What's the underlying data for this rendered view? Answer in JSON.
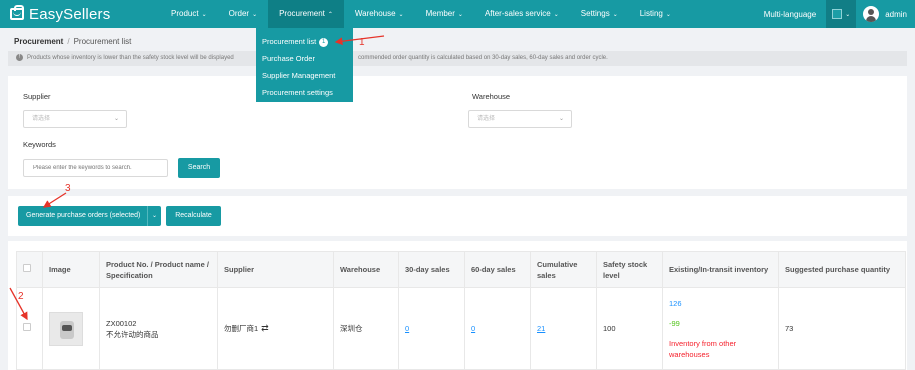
{
  "brand": {
    "name": "EasySellers",
    "accent": "#179aa3"
  },
  "nav": {
    "items": [
      {
        "label": "Product"
      },
      {
        "label": "Order"
      },
      {
        "label": "Procurement"
      },
      {
        "label": "Warehouse"
      },
      {
        "label": "Member"
      },
      {
        "label": "After-sales service"
      },
      {
        "label": "Settings"
      },
      {
        "label": "Listing"
      }
    ],
    "language": "Multi-language",
    "user": "admin"
  },
  "dropdown": {
    "items": [
      {
        "label": "Procurement list",
        "badge": "1"
      },
      {
        "label": "Purchase Order"
      },
      {
        "label": "Supplier Management"
      },
      {
        "label": "Procurement settings"
      }
    ]
  },
  "breadcrumb": {
    "parent": "Procurement",
    "separator": "/",
    "current": "Procurement list"
  },
  "tip": {
    "left": "Products whose inventory is lower than the safety stock level will be displayed",
    "right": "commended order quantity is calculated based on 30-day sales, 60-day sales and order cycle."
  },
  "filter": {
    "supplier_label": "Supplier",
    "supplier_value": "请选择",
    "warehouse_label": "Warehouse",
    "warehouse_value": "请选择",
    "keywords_label": "Keywords",
    "keywords_placeholder": "Please enter the keywords to search.",
    "search_label": "Search"
  },
  "actions": {
    "generate_label": "Generate purchase orders (selected)",
    "recalculate_label": "Recalculate"
  },
  "table": {
    "headers": {
      "image": "Image",
      "product": "Product No. / Product name / Specification",
      "supplier": "Supplier",
      "warehouse": "Warehouse",
      "sales30": "30-day sales",
      "sales60": "60-day sales",
      "cumulative": "Cumulative sales",
      "safety": "Safety stock level",
      "existing": "Existing/In-transit inventory",
      "suggested": "Suggested purchase quantity"
    },
    "rows": [
      {
        "product_no": "ZX00102",
        "product_name": "不允许动的商品",
        "supplier": "勿删厂商1",
        "warehouse": "深圳仓",
        "sales30": "0",
        "sales60": "0",
        "cumulative": "21",
        "safety": "100",
        "existing": "126",
        "in_transit": "-99",
        "other_warehouse": "Inventory from other warehouses",
        "suggested": "73"
      }
    ]
  },
  "annotations": {
    "a1": "1",
    "a2": "2",
    "a3": "3",
    "color": "#e63329"
  }
}
